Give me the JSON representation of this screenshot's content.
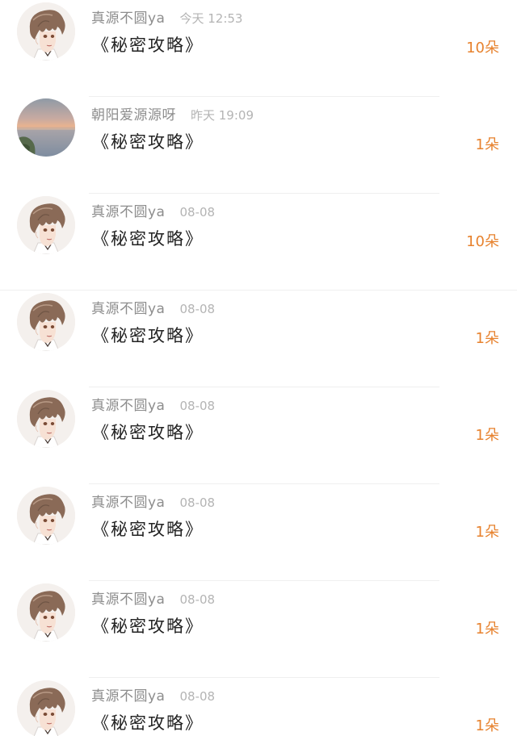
{
  "colors": {
    "count": "#e7822e",
    "username": "#8d8d8d",
    "timestamp": "#b4b4b4",
    "title": "#222222",
    "divider": "#efefef"
  },
  "items": [
    {
      "username": "真源不圆ya",
      "time": "今天 12:53",
      "title": "《秘密攻略》",
      "count": "10朵",
      "avatar": "anime-boy-avatar"
    },
    {
      "username": "朝阳爱源源呀",
      "time": "昨天 19:09",
      "title": "《秘密攻略》",
      "count": "1朵",
      "avatar": "sunset-sea-avatar"
    },
    {
      "username": "真源不圆ya",
      "time": "08-08",
      "title": "《秘密攻略》",
      "count": "10朵",
      "avatar": "anime-boy-avatar"
    },
    {
      "username": "真源不圆ya",
      "time": "08-08",
      "title": "《秘密攻略》",
      "count": "1朵",
      "avatar": "anime-boy-avatar"
    },
    {
      "username": "真源不圆ya",
      "time": "08-08",
      "title": "《秘密攻略》",
      "count": "1朵",
      "avatar": "anime-boy-avatar"
    },
    {
      "username": "真源不圆ya",
      "time": "08-08",
      "title": "《秘密攻略》",
      "count": "1朵",
      "avatar": "anime-boy-avatar"
    },
    {
      "username": "真源不圆ya",
      "time": "08-08",
      "title": "《秘密攻略》",
      "count": "1朵",
      "avatar": "anime-boy-avatar"
    },
    {
      "username": "真源不圆ya",
      "time": "08-08",
      "title": "《秘密攻略》",
      "count": "1朵",
      "avatar": "anime-boy-avatar"
    }
  ]
}
